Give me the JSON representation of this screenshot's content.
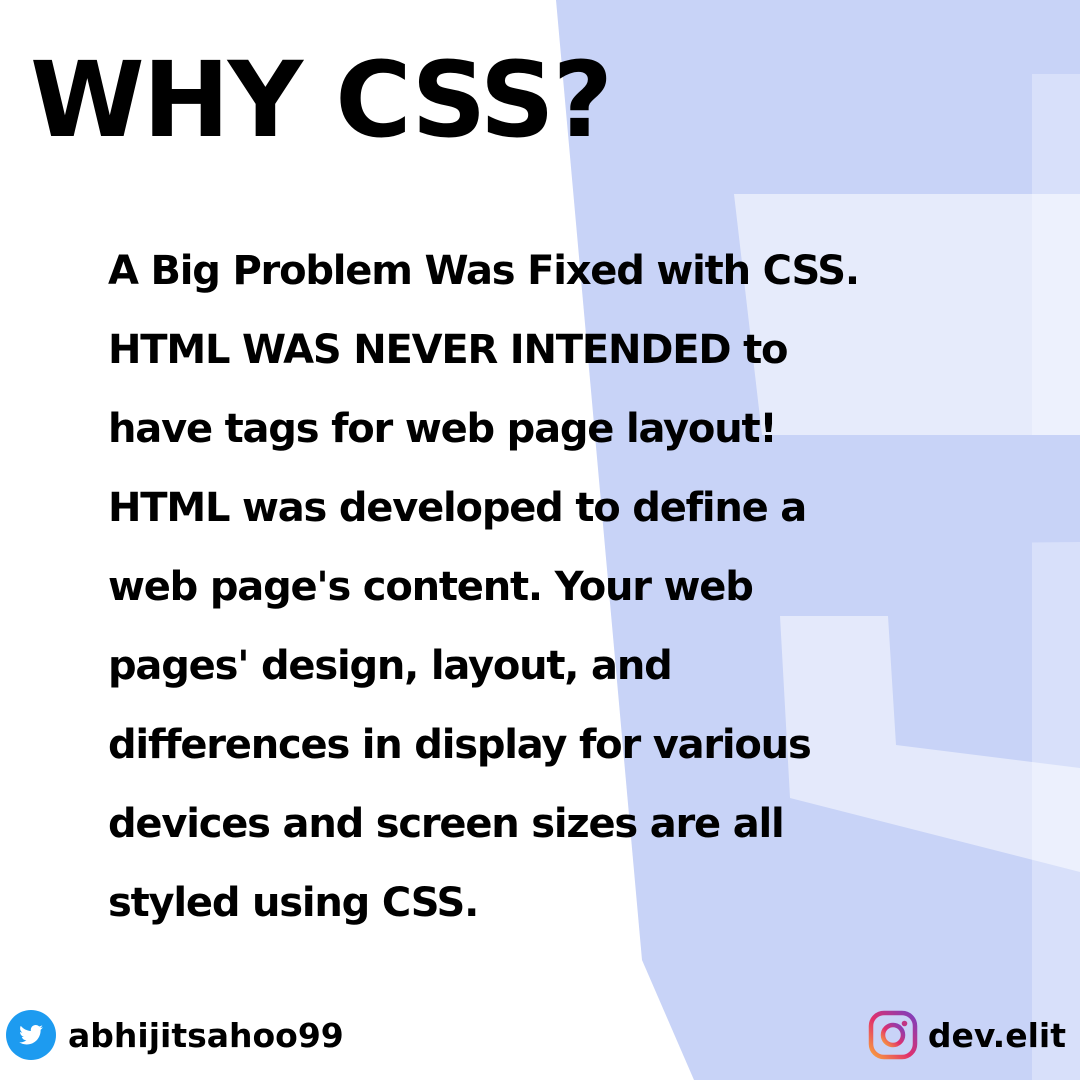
{
  "title": "WHY CSS?",
  "body_lines": [
    "A Big Problem Was Fixed with CSS.",
    "HTML WAS NEVER INTENDED to",
    "have tags for web page layout!",
    "HTML was developed to define a",
    "web page's content. Your web",
    "pages' design, layout, and",
    "differences in display for various",
    "devices and screen sizes are all",
    "styled using CSS."
  ],
  "social": {
    "twitter": {
      "icon": "twitter-icon",
      "handle": "abhijitsahoo99"
    },
    "instagram": {
      "icon": "instagram-icon",
      "handle": "dev.elit"
    }
  },
  "colors": {
    "background": "#ffffff",
    "text": "#000000",
    "logo_shield": "#c8d3f7",
    "twitter_blue": "#1d9bf0"
  }
}
